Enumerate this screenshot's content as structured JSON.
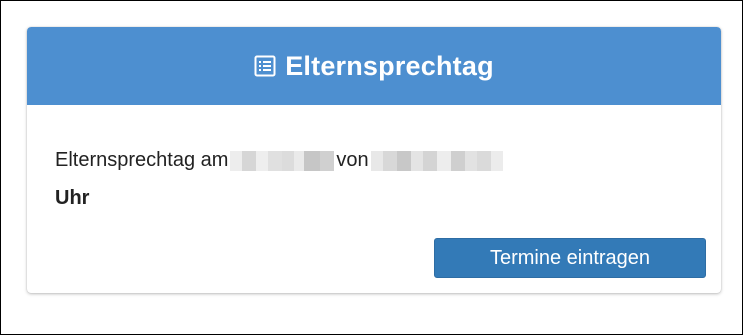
{
  "panel": {
    "title": "Elternsprechtag",
    "header_icon": "list-alt-icon",
    "header_color": "#4d8fd0"
  },
  "body": {
    "text_prefix": "Elternsprechtag am",
    "text_middle": "von",
    "text_suffix": "Uhr"
  },
  "actions": {
    "primary_label": "Termine eintragen",
    "primary_color": "#337ab7"
  }
}
